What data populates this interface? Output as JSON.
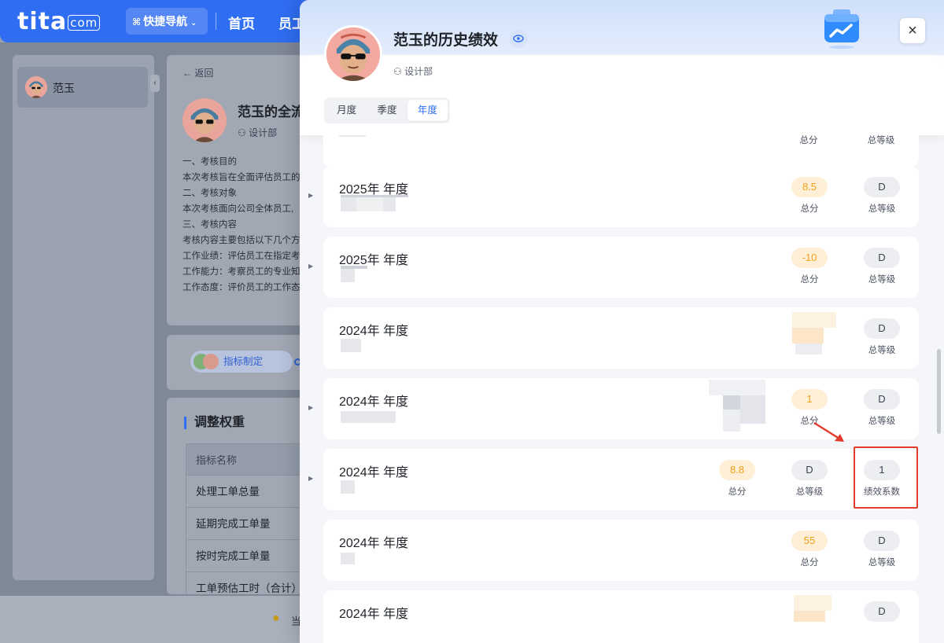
{
  "topbar": {
    "logo_text": "tita",
    "logo_suffix": "com",
    "quick_nav_label": "快捷导航",
    "nav_items": [
      "首页",
      "员工"
    ]
  },
  "sidebar": {
    "person_name": "范玉"
  },
  "detail_card": {
    "back_label": "返回",
    "title": "范玉的全流",
    "dept": "设计部",
    "desc_lines": [
      "一、考核目的",
      "本次考核旨在全面评估员工的",
      "二、考核对象",
      "本次考核面向公司全体员工,",
      "三、考核内容",
      "考核内容主要包括以下几个方",
      "工作业绩：评估员工在指定考",
      "工作能力：考察员工的专业知",
      "工作态度：评价员工的工作态"
    ]
  },
  "flow": {
    "step_label": "指标制定"
  },
  "weights": {
    "title": "调整权重",
    "table_header": "指标名称",
    "rows": [
      "处理工单总量",
      "延期完成工单量",
      "按时完成工单量",
      "工单预估工时（合计）"
    ]
  },
  "footer": {
    "text": "当"
  },
  "drawer": {
    "title": "范玉的历史绩效",
    "dept": "设计部",
    "close_label": "×",
    "tabs": [
      "月度",
      "季度",
      "年度"
    ],
    "active_tab": "年度",
    "partial_labels": {
      "score": "总分",
      "grade": "总等级"
    },
    "records": [
      {
        "name": "2025年 年度",
        "score": "8.5",
        "score_label": "总分",
        "grade": "D",
        "grade_label": "总等级"
      },
      {
        "name": "2025年 年度",
        "score": "-10",
        "score_label": "总分",
        "grade": "D",
        "grade_label": "总等级"
      },
      {
        "name": "2024年 年度",
        "score": "",
        "score_label": "",
        "grade": "D",
        "grade_label": "总等级"
      },
      {
        "name": "2024年 年度",
        "score": "1",
        "score_label": "总分",
        "grade": "D",
        "grade_label": "总等级"
      },
      {
        "name": "2024年 年度",
        "score": "8.8",
        "score_label": "总分",
        "grade": "D",
        "grade_label": "总等级",
        "coef": "1",
        "coef_label": "绩效系数"
      },
      {
        "name": "2024年 年度",
        "score": "55",
        "score_label": "总分",
        "grade": "D",
        "grade_label": "总等级"
      },
      {
        "name": "2024年 年度",
        "score": "",
        "score_label": "",
        "grade": "D",
        "grade_label": ""
      }
    ]
  },
  "colors": {
    "primary": "#2f6df2",
    "score_orange": "#f2a019",
    "highlight_red": "#e23c2c"
  }
}
